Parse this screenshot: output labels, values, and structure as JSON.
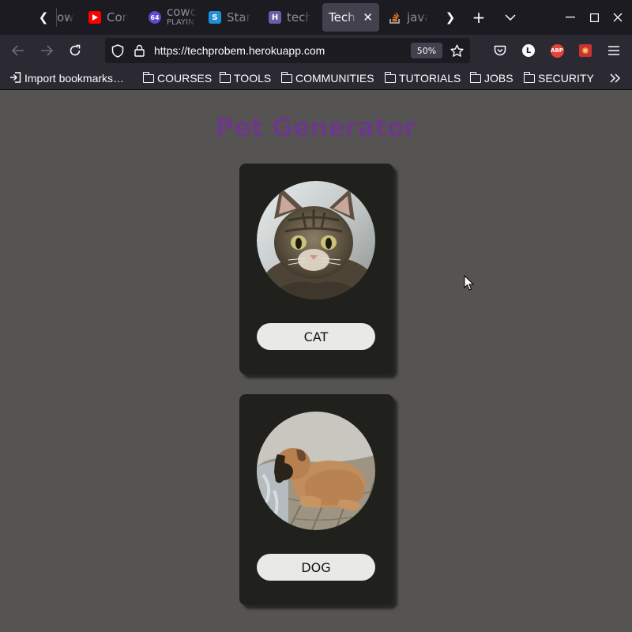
{
  "tabs": [
    {
      "title": "ow"
    },
    {
      "title": "Com"
    },
    {
      "title": "cowc",
      "subtitle": "PLAYIN"
    },
    {
      "title": "Start"
    },
    {
      "title": "tech"
    },
    {
      "title": "Tech c",
      "active": true
    },
    {
      "title": "javas"
    }
  ],
  "nav": {
    "url": "https://techprobem.herokuapp.com",
    "zoom": "50%",
    "account_initial": "L",
    "adblock_label": "ABP"
  },
  "bookmarks": [
    {
      "label": "Import bookmarks…",
      "icon": "import-icon"
    },
    {
      "label": "COURSES",
      "icon": "folder-icon"
    },
    {
      "label": "TOOLS",
      "icon": "folder-icon"
    },
    {
      "label": "COMMUNITIES",
      "icon": "folder-icon"
    },
    {
      "label": "TUTORIALS",
      "icon": "folder-icon"
    },
    {
      "label": "JOBS",
      "icon": "folder-icon"
    },
    {
      "label": "SECURITY",
      "icon": "folder-icon"
    }
  ],
  "page": {
    "title": "Pet Generator",
    "cards": [
      {
        "button_label": "CAT",
        "image": "cat-photo"
      },
      {
        "button_label": "DOG",
        "image": "dog-photo"
      }
    ]
  },
  "colors": {
    "page_background": "#555452",
    "card_background": "#20201d",
    "title_color": "#6b3a85",
    "button_background": "#e9e9e8"
  }
}
